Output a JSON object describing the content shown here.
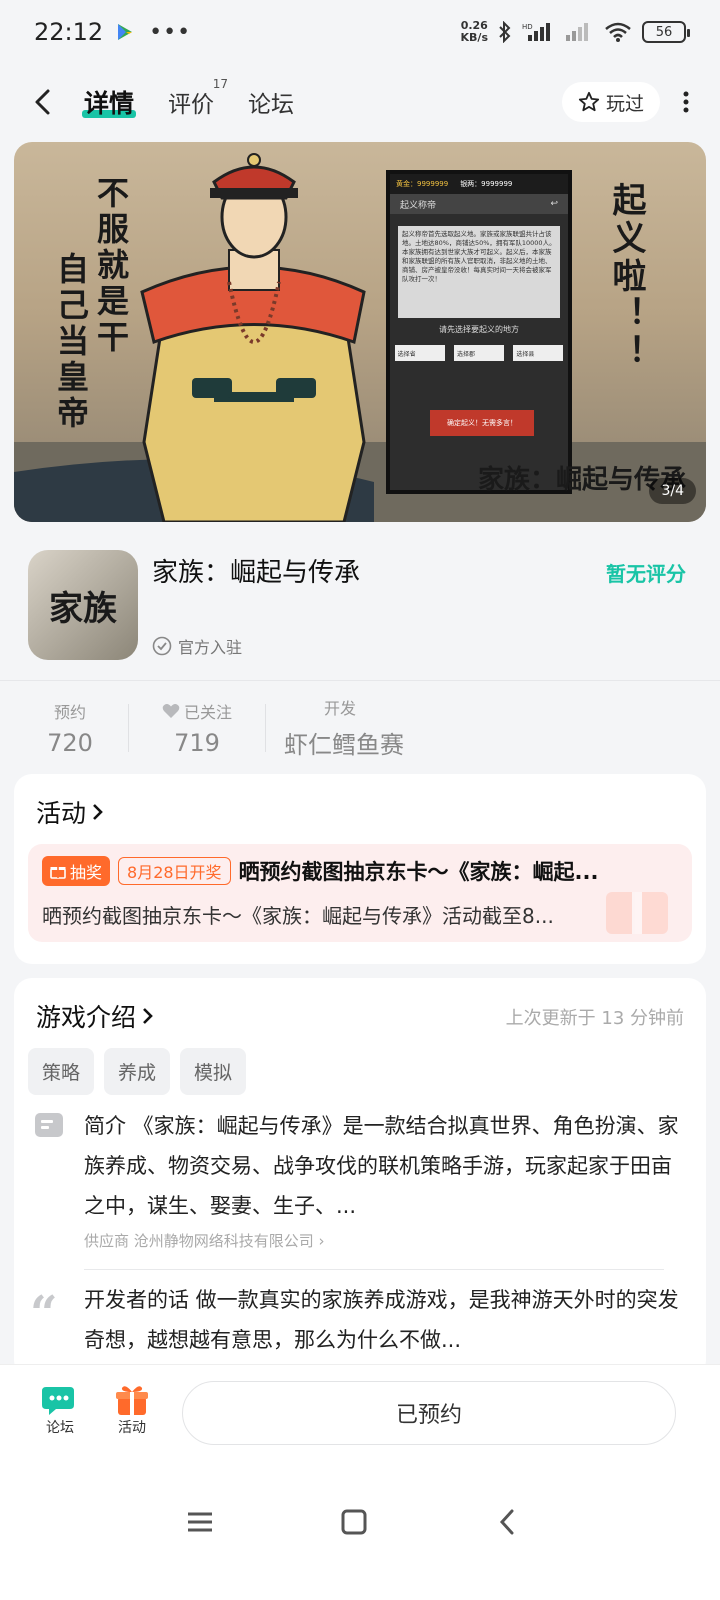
{
  "status": {
    "time": "22:12",
    "net_speed_top": "0.26",
    "net_speed_bottom": "KB/s",
    "battery": "56"
  },
  "nav": {
    "tabs": [
      {
        "label": "详情"
      },
      {
        "label": "评价",
        "count": "17"
      },
      {
        "label": "论坛"
      }
    ],
    "played_label": "玩过"
  },
  "banner": {
    "left_text_1": "不服就是干",
    "left_text_2": "自己当皇帝",
    "right_text": "起义啦！！",
    "game_ui": {
      "gold": "黄金：9999999",
      "silver": "银两：9999999",
      "header": "起义称帝",
      "body": "起义称帝首先选取起义地。家族或家族联盟共计占该地。土地达80%，商铺达50%，拥有军队10000人。本家族拥有达到世家大族才可起义。起义后，本家族和家族联盟的所有族人官职取消，非起义地的土地、商铺、房产被皇帝没收！每真实时间一天将会被家军队攻打一次！",
      "ask": "请先选择要起义的地方",
      "select_1": "选择省",
      "select_2": "选择郡",
      "select_3": "选择县",
      "confirm": "确定起义！无需多言！"
    },
    "logo_text": "家族：崛起与传承",
    "counter": "3/4"
  },
  "app": {
    "icon_text": "家族",
    "name": "家族：崛起与传承",
    "official": "官方入驻",
    "rating": "暂无评分"
  },
  "stats": [
    {
      "label": "预约",
      "value": "720"
    },
    {
      "label": "已关注",
      "value": "719"
    },
    {
      "label": "开发",
      "value": "虾仁鳕鱼赛"
    }
  ],
  "activity": {
    "title": "活动",
    "badge": "抽奖",
    "date": "8月28日开奖",
    "headline": "晒预约截图抽京东卡～《家族：崛起...",
    "desc": "晒预约截图抽京东卡～《家族：崛起与传承》活动截至8..."
  },
  "intro": {
    "title": "游戏介绍",
    "updated": "上次更新于 13 分钟前",
    "tags": [
      "策略",
      "养成",
      "模拟"
    ],
    "summary": "简介 《家族：崛起与传承》是一款结合拟真世界、角色扮演、家族养成、物资交易、战争攻伐的联机策略手游，玩家起家于田亩之中，谋生、娶妻、生子、...",
    "supplier": "供应商 沧州静物网络科技有限公司 ›",
    "dev_words": "开发者的话 做一款真实的家族养成游戏，是我神游天外时的突发奇想，越想越有意思，那么为什么不做..."
  },
  "bottom": {
    "forum": "论坛",
    "activity": "活动",
    "reserve": "已预约"
  },
  "colors": {
    "accent": "#19c4a6",
    "orange": "#ff6a2b",
    "bg": "#f4f5f7"
  }
}
